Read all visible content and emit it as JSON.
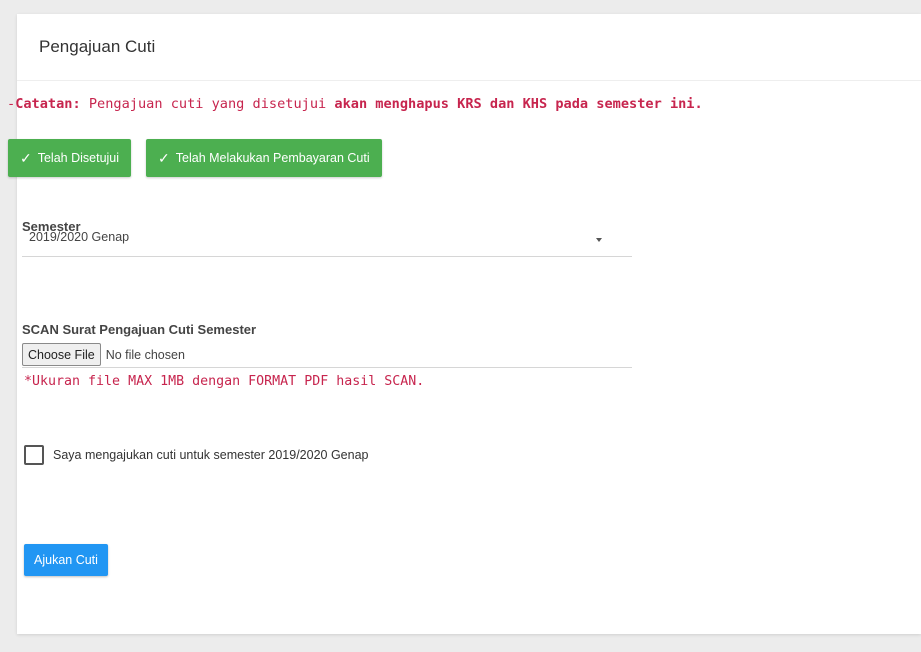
{
  "page": {
    "title": "Pengajuan Cuti"
  },
  "note": {
    "prefix": "-",
    "label": "Catatan:",
    "text": " Pengajuan cuti yang disetujui ",
    "emphasis": "akan menghapus KRS dan KHS pada semester ini."
  },
  "status_buttons": {
    "approved": "Telah Disetujui",
    "paid": "Telah Melakukan Pembayaran Cuti",
    "icon": "check-icon"
  },
  "semester": {
    "label": "Semester",
    "selected": "2019/2020 Genap"
  },
  "upload": {
    "label": "SCAN Surat Pengajuan Cuti Semester",
    "button": "Choose File",
    "status": "No file chosen",
    "hint": "*Ukuran file MAX 1MB dengan FORMAT PDF hasil SCAN."
  },
  "confirm": {
    "label": "Saya mengajukan cuti untuk semester 2019/2020 Genap",
    "checked": false
  },
  "submit": {
    "label": "Ajukan Cuti"
  },
  "colors": {
    "accent_green": "#4caf50",
    "accent_blue": "#2196f3",
    "note_red": "#c7254e"
  }
}
